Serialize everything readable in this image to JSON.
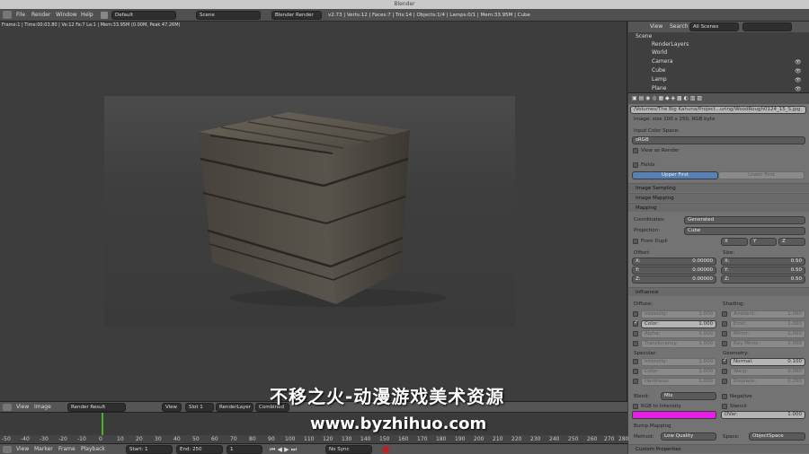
{
  "window_title": "Blender",
  "top_menu": [
    "File",
    "Render",
    "Window",
    "Help"
  ],
  "layout_field": "Default",
  "scene_field": "Scene",
  "engine_field": "Blender Render",
  "stats": "v2.73 | Verts:12 | Faces:7 | Tris:14 | Objects:1/4 | Lamps:0/1 | Mem:33.95M | Cube",
  "render_status": "Frame:1 | Time:00:03.80 | Ve:12 Fa:7 La:1 | Mem:33.95M (0.00M, Peak 47.26M)",
  "outliner": {
    "view_label": "View",
    "search_label": "Search",
    "filter": "All Scenes",
    "items": [
      "Scene",
      "RenderLayers",
      "World",
      "Camera",
      "Cube",
      "Lamp",
      "Plane"
    ]
  },
  "texture_props": {
    "filepath": "/Volumes/The Big Kahuna/Project...uring/WoodRough0124_15_S.jpg",
    "image_info": "Image: size 100 x 250, RGB byte",
    "input_color_space_label": "Input Color Space:",
    "color_space": "sRGB",
    "view_as_render": "View as Render",
    "fields": "Fields",
    "upper_first": "Upper First",
    "lower_first": "Lower First",
    "image_sampling": "Image Sampling",
    "image_mapping": "Image Mapping",
    "mapping": "Mapping",
    "coordinates_label": "Coordinates:",
    "coordinates": "Generated",
    "projection_label": "Projection:",
    "projection": "Cube",
    "from_dupli": "From Dupli",
    "axes": [
      "X",
      "Y",
      "Z"
    ],
    "offset_label": "Offset:",
    "size_label": "Size:",
    "offset": [
      {
        "axis": "X:",
        "value": "0.00000"
      },
      {
        "axis": "Y:",
        "value": "0.00000"
      },
      {
        "axis": "Z:",
        "value": "0.00000"
      }
    ],
    "size": [
      {
        "axis": "X:",
        "value": "0.50"
      },
      {
        "axis": "Y:",
        "value": "0.50"
      },
      {
        "axis": "Z:",
        "value": "0.50"
      }
    ],
    "influence": "Influence",
    "diffuse_label": "Diffuse:",
    "shading_label": "Shading:",
    "diffuse": [
      {
        "name": "Intensity:",
        "value": "1.000",
        "on": false
      },
      {
        "name": "Color:",
        "value": "1.000",
        "on": true
      },
      {
        "name": "Alpha:",
        "value": "1.000",
        "on": false
      },
      {
        "name": "Translucency:",
        "value": "1.000",
        "on": false
      }
    ],
    "shading": [
      {
        "name": "Ambient:",
        "value": "1.000"
      },
      {
        "name": "Emit:",
        "value": "1.000"
      },
      {
        "name": "Mirror:",
        "value": "1.000"
      },
      {
        "name": "Ray Mirror:",
        "value": "1.000"
      }
    ],
    "specular_label": "Specular:",
    "geometry_label": "Geometry:",
    "specular": [
      {
        "name": "Intensity:",
        "value": "1.000"
      },
      {
        "name": "Color:",
        "value": "1.000"
      },
      {
        "name": "Hardness:",
        "value": "1.000"
      }
    ],
    "geometry": [
      {
        "name": "Normal:",
        "value": "0.100",
        "on": true
      },
      {
        "name": "Warp:",
        "value": "0.000",
        "on": false
      },
      {
        "name": "Displace:",
        "value": "0.200",
        "on": false
      }
    ],
    "blend_label": "Blend:",
    "blend": "Mix",
    "negative": "Negative",
    "rgb_to_intensity": "RGB to Intensity",
    "stencil": "Stencil",
    "dvar": "DVar:",
    "dvar_value": "1.000",
    "bump_mapping": "Bump Mapping",
    "method_label": "Method:",
    "method": "Low Quality",
    "space_label": "Space:",
    "space": "ObjectSpace",
    "custom_properties": "Custom Properties",
    "swatch_color": "#e81ee8"
  },
  "image_editor_header": {
    "view": "View",
    "image": "Image",
    "image_name": "Render Result",
    "view2": "View",
    "slot": "Slot 1",
    "layer": "RenderLayer",
    "pass": "Combined"
  },
  "timeline": {
    "ticks": [
      "-50",
      "-40",
      "-30",
      "-20",
      "-10",
      "0",
      "10",
      "20",
      "30",
      "40",
      "50",
      "60",
      "70",
      "80",
      "90",
      "100",
      "110",
      "120",
      "130",
      "140",
      "150",
      "160",
      "170",
      "180",
      "190",
      "200",
      "210",
      "220",
      "230",
      "240",
      "250",
      "260",
      "270",
      "280"
    ],
    "footer": [
      "View",
      "Marker",
      "Frame",
      "Playback"
    ],
    "start_label": "Start:",
    "start": "1",
    "end_label": "End:",
    "end": "250",
    "current": "1",
    "sync": "No Sync"
  },
  "watermark": "不移之火-动漫游戏美术资源",
  "watermark_url": "www.byzhihuo.com"
}
